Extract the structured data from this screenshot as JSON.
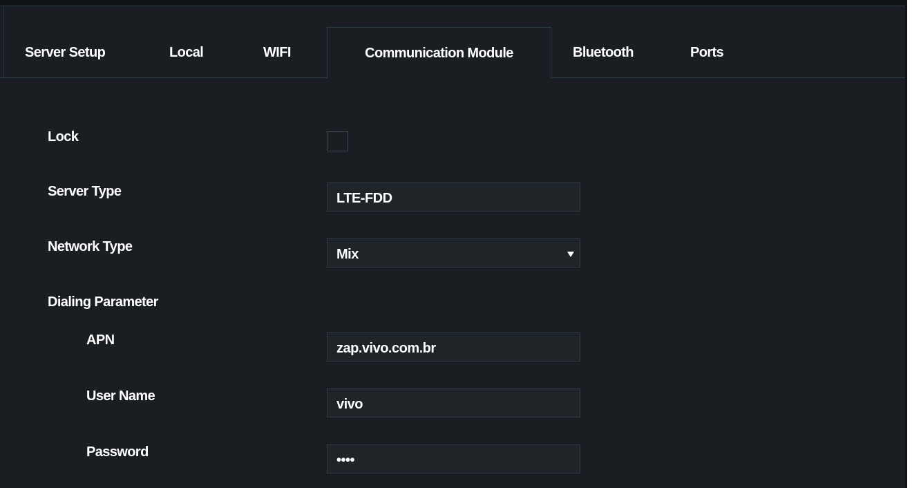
{
  "tabs": [
    {
      "label": "Server Setup"
    },
    {
      "label": "Local"
    },
    {
      "label": "WIFI"
    },
    {
      "label": "Communication Module",
      "active": true
    },
    {
      "label": "Bluetooth"
    },
    {
      "label": "Ports"
    }
  ],
  "form": {
    "lock": {
      "label": "Lock",
      "checked": false
    },
    "server_type": {
      "label": "Server Type",
      "value": "LTE-FDD"
    },
    "network_type": {
      "label": "Network Type",
      "value": "Mix"
    },
    "dialing_parameter": {
      "label": "Dialing Parameter"
    },
    "apn": {
      "label": "APN",
      "value": "zap.vivo.com.br"
    },
    "user_name": {
      "label": "User Name",
      "value": "vivo"
    },
    "password": {
      "label": "Password",
      "value": "••••"
    }
  },
  "colors": {
    "background": "#1a1e22",
    "border": "#2b3f4b",
    "field_background": "#1f2428",
    "text": "#ffffff"
  }
}
